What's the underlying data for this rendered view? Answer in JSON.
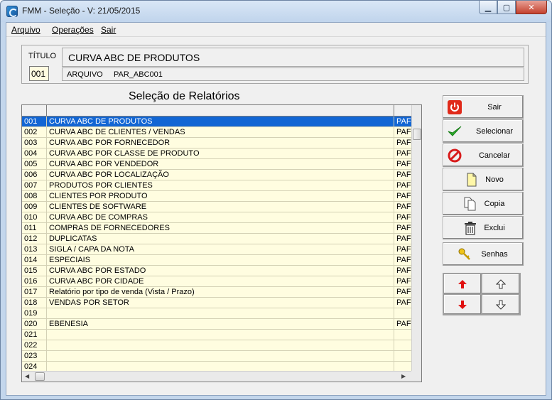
{
  "window": {
    "title": "FMM - Seleção - V: 21/05/2015",
    "minimize": "▁",
    "maximize": "▢",
    "close": "✕"
  },
  "menu": [
    "Arquivo",
    "Operações",
    "Sair"
  ],
  "header": {
    "titulo_label": "TÍTULO",
    "titulo_code": "001",
    "titulo_value": "CURVA ABC DE PRODUTOS",
    "arquivo_label": "ARQUIVO",
    "arquivo_value": "PAR_ABC001"
  },
  "section_title": "Seleção de Relatórios",
  "rows": [
    {
      "code": "001",
      "name": "CURVA ABC DE PRODUTOS",
      "file": "PAF",
      "selected": true
    },
    {
      "code": "002",
      "name": "CURVA ABC DE CLIENTES / VENDAS",
      "file": "PAF"
    },
    {
      "code": "003",
      "name": "CURVA ABC POR FORNECEDOR",
      "file": "PAF"
    },
    {
      "code": "004",
      "name": "CURVA ABC POR CLASSE DE PRODUTO",
      "file": "PAF"
    },
    {
      "code": "005",
      "name": "CURVA ABC POR VENDEDOR",
      "file": "PAF"
    },
    {
      "code": "006",
      "name": "CURVA ABC POR LOCALIZAÇÃO",
      "file": "PAF"
    },
    {
      "code": "007",
      "name": "PRODUTOS POR CLIENTES",
      "file": "PAF"
    },
    {
      "code": "008",
      "name": "CLIENTES POR PRODUTO",
      "file": "PAF"
    },
    {
      "code": "009",
      "name": "CLIENTES DE SOFTWARE",
      "file": "PAF"
    },
    {
      "code": "010",
      "name": "CURVA ABC DE COMPRAS",
      "file": "PAF"
    },
    {
      "code": "011",
      "name": "COMPRAS DE FORNECEDORES",
      "file": "PAF"
    },
    {
      "code": "012",
      "name": "DUPLICATAS",
      "file": "PAF"
    },
    {
      "code": "013",
      "name": "SIGLA / CAPA DA NOTA",
      "file": "PAF"
    },
    {
      "code": "014",
      "name": "ESPECIAIS",
      "file": "PAF"
    },
    {
      "code": "015",
      "name": "CURVA ABC POR ESTADO",
      "file": "PAF"
    },
    {
      "code": "016",
      "name": "CURVA ABC POR CIDADE",
      "file": "PAF"
    },
    {
      "code": "017",
      "name": "Relatório por tipo de venda (Vista / Prazo)",
      "file": "PAF"
    },
    {
      "code": "018",
      "name": "VENDAS POR SETOR",
      "file": "PAF"
    },
    {
      "code": "019",
      "name": "",
      "file": ""
    },
    {
      "code": "020",
      "name": "EBENESIA",
      "file": "PAF"
    },
    {
      "code": "021",
      "name": "",
      "file": ""
    },
    {
      "code": "022",
      "name": "",
      "file": ""
    },
    {
      "code": "023",
      "name": "",
      "file": ""
    },
    {
      "code": "024",
      "name": "",
      "file": ""
    }
  ],
  "buttons": {
    "sair": "Sair",
    "selecionar": "Selecionar",
    "cancelar": "Cancelar",
    "novo": "Novo",
    "copia": "Copia",
    "exclui": "Exclui",
    "senhas": "Senhas"
  },
  "colors": {
    "row_bg": "#fffde0",
    "selected_bg": "#1266d4",
    "arrow_red": "#e01010"
  }
}
